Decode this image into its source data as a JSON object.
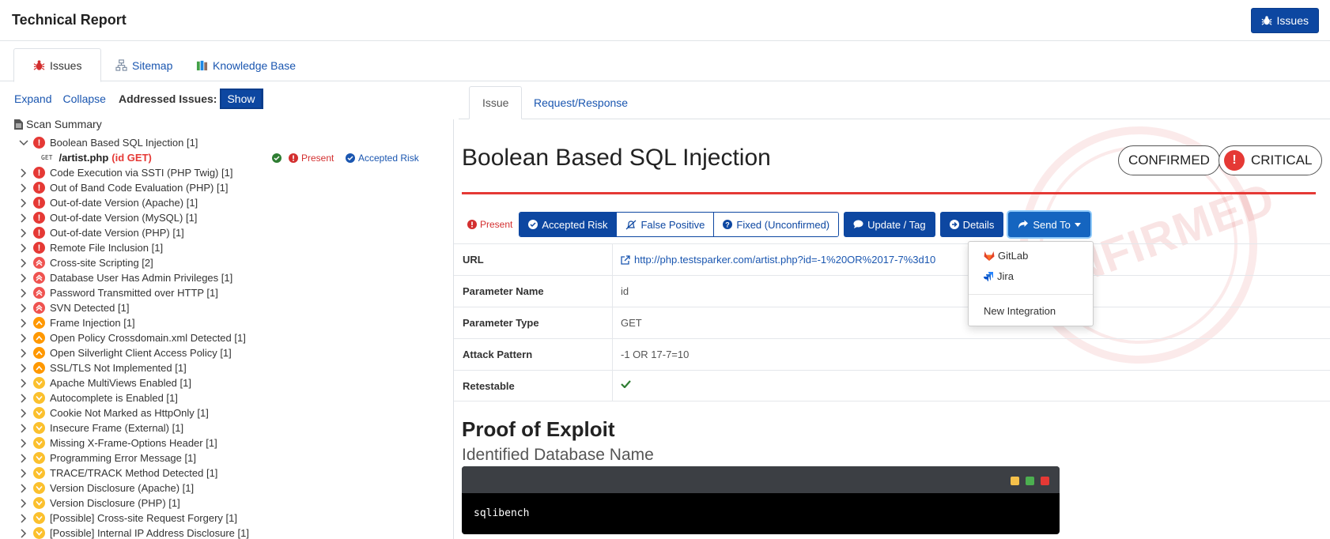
{
  "header": {
    "title": "Technical Report",
    "issues_button": "Issues"
  },
  "main_tabs": [
    {
      "label": "Issues",
      "icon": "bug-icon",
      "active": true
    },
    {
      "label": "Sitemap",
      "icon": "sitemap-icon",
      "active": false
    },
    {
      "label": "Knowledge Base",
      "icon": "books-icon",
      "active": false
    }
  ],
  "left": {
    "expand": "Expand",
    "collapse": "Collapse",
    "addressed_label": "Addressed Issues:",
    "show_button": "Show",
    "scan_summary": "Scan Summary",
    "first_issue": {
      "title": "Boolean Based SQL Injection [1]",
      "get_icon_text": "GET",
      "path": "/artist.php",
      "param": "(id GET)",
      "status_present": "Present",
      "status_accepted": "Accepted Risk"
    },
    "issues": [
      {
        "title": "Code Execution via SSTI (PHP Twig) [1]",
        "severity": "critical"
      },
      {
        "title": "Out of Band Code Evaluation (PHP) [1]",
        "severity": "critical"
      },
      {
        "title": "Out-of-date Version (Apache) [1]",
        "severity": "critical"
      },
      {
        "title": "Out-of-date Version (MySQL) [1]",
        "severity": "critical"
      },
      {
        "title": "Out-of-date Version (PHP) [1]",
        "severity": "critical"
      },
      {
        "title": "Remote File Inclusion [1]",
        "severity": "critical"
      },
      {
        "title": "Cross-site Scripting [2]",
        "severity": "high"
      },
      {
        "title": "Database User Has Admin Privileges [1]",
        "severity": "high"
      },
      {
        "title": "Password Transmitted over HTTP [1]",
        "severity": "high"
      },
      {
        "title": "SVN Detected [1]",
        "severity": "high"
      },
      {
        "title": "Frame Injection [1]",
        "severity": "medium"
      },
      {
        "title": "Open Policy Crossdomain.xml Detected [1]",
        "severity": "medium"
      },
      {
        "title": "Open Silverlight Client Access Policy [1]",
        "severity": "medium"
      },
      {
        "title": "SSL/TLS Not Implemented [1]",
        "severity": "medium"
      },
      {
        "title": "Apache MultiViews Enabled [1]",
        "severity": "low"
      },
      {
        "title": "Autocomplete is Enabled [1]",
        "severity": "low"
      },
      {
        "title": "Cookie Not Marked as HttpOnly [1]",
        "severity": "low"
      },
      {
        "title": "Insecure Frame (External) [1]",
        "severity": "low"
      },
      {
        "title": "Missing X-Frame-Options Header [1]",
        "severity": "low"
      },
      {
        "title": "Programming Error Message [1]",
        "severity": "low"
      },
      {
        "title": "TRACE/TRACK Method Detected [1]",
        "severity": "low"
      },
      {
        "title": "Version Disclosure (Apache) [1]",
        "severity": "low"
      },
      {
        "title": "Version Disclosure (PHP) [1]",
        "severity": "low"
      },
      {
        "title": "[Possible] Cross-site Request Forgery [1]",
        "severity": "low"
      },
      {
        "title": "[Possible] Internal IP Address Disclosure [1]",
        "severity": "low"
      }
    ]
  },
  "right_tabs": [
    {
      "label": "Issue",
      "active": true
    },
    {
      "label": "Request/Response",
      "active": false
    }
  ],
  "issue": {
    "title": "Boolean Based SQL Injection",
    "badge_confirmed": "CONFIRMED",
    "badge_critical": "CRITICAL",
    "stamp_text": "CONFIRMED",
    "status_present": "Present",
    "actions": {
      "accepted_risk": "Accepted Risk",
      "false_positive": "False Positive",
      "fixed_unconfirmed": "Fixed (Unconfirmed)",
      "update_tag": "Update / Tag",
      "details": "Details",
      "send_to": "Send To"
    },
    "send_to_menu": {
      "gitlab": "GitLab",
      "jira": "Jira",
      "new_integration": "New Integration"
    },
    "properties": {
      "url_label": "URL",
      "url_value": "http://php.testsparker.com/artist.php?id=-1%20OR%2017-7%3d10",
      "param_name_label": "Parameter Name",
      "param_name_value": "id",
      "param_type_label": "Parameter Type",
      "param_type_value": "GET",
      "attack_label": "Attack Pattern",
      "attack_value": "-1 OR 17-7=10",
      "retestable_label": "Retestable"
    },
    "proof_title": "Proof of Exploit",
    "proof_subtitle": "Identified Database Name",
    "terminal_output": "sqlibench"
  },
  "colors": {
    "primary": "#0d47a1",
    "critical": "#e53935",
    "medium": "#ff9800",
    "low": "#fbc02d",
    "terminal_dots": [
      "#f5c04a",
      "#4caf50",
      "#e53935"
    ]
  }
}
